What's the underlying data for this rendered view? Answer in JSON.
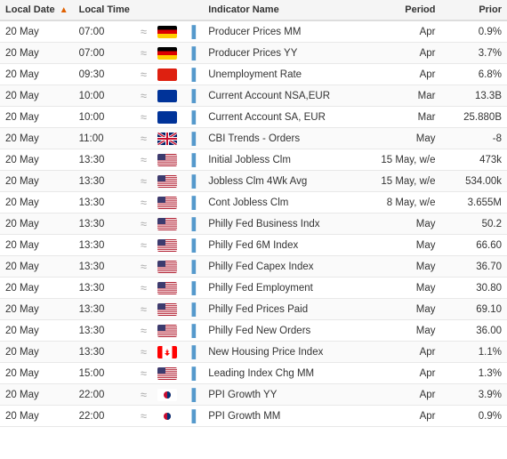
{
  "header": {
    "col_date": "Local Date",
    "col_time": "Local Time",
    "col_name": "Indicator Name",
    "col_period": "Period",
    "col_prior": "Prior"
  },
  "rows": [
    {
      "date": "20 May",
      "time": "07:00",
      "tilde": "≈",
      "flag": "de",
      "name": "Producer Prices MM",
      "period": "Apr",
      "prior": "0.9%"
    },
    {
      "date": "20 May",
      "time": "07:00",
      "tilde": "≈",
      "flag": "de",
      "name": "Producer Prices YY",
      "period": "Apr",
      "prior": "3.7%"
    },
    {
      "date": "20 May",
      "time": "09:30",
      "tilde": "≈",
      "flag": "hk",
      "name": "Unemployment Rate",
      "period": "Apr",
      "prior": "6.8%"
    },
    {
      "date": "20 May",
      "time": "10:00",
      "tilde": "≈",
      "flag": "eu",
      "name": "Current Account NSA,EUR",
      "period": "Mar",
      "prior": "13.3B"
    },
    {
      "date": "20 May",
      "time": "10:00",
      "tilde": "≈",
      "flag": "eu",
      "name": "Current Account SA, EUR",
      "period": "Mar",
      "prior": "25.880B"
    },
    {
      "date": "20 May",
      "time": "11:00",
      "tilde": "≈",
      "flag": "gb",
      "name": "CBI Trends - Orders",
      "period": "May",
      "prior": "-8"
    },
    {
      "date": "20 May",
      "time": "13:30",
      "tilde": "≈",
      "flag": "us",
      "name": "Initial Jobless Clm",
      "period": "15 May, w/e",
      "prior": "473k"
    },
    {
      "date": "20 May",
      "time": "13:30",
      "tilde": "≈",
      "flag": "us",
      "name": "Jobless Clm 4Wk Avg",
      "period": "15 May, w/e",
      "prior": "534.00k"
    },
    {
      "date": "20 May",
      "time": "13:30",
      "tilde": "≈",
      "flag": "us",
      "name": "Cont Jobless Clm",
      "period": "8 May, w/e",
      "prior": "3.655M"
    },
    {
      "date": "20 May",
      "time": "13:30",
      "tilde": "≈",
      "flag": "us",
      "name": "Philly Fed Business Indx",
      "period": "May",
      "prior": "50.2"
    },
    {
      "date": "20 May",
      "time": "13:30",
      "tilde": "≈",
      "flag": "us",
      "name": "Philly Fed 6M Index",
      "period": "May",
      "prior": "66.60"
    },
    {
      "date": "20 May",
      "time": "13:30",
      "tilde": "≈",
      "flag": "us",
      "name": "Philly Fed Capex Index",
      "period": "May",
      "prior": "36.70"
    },
    {
      "date": "20 May",
      "time": "13:30",
      "tilde": "≈",
      "flag": "us",
      "name": "Philly Fed Employment",
      "period": "May",
      "prior": "30.80"
    },
    {
      "date": "20 May",
      "time": "13:30",
      "tilde": "≈",
      "flag": "us",
      "name": "Philly Fed Prices Paid",
      "period": "May",
      "prior": "69.10"
    },
    {
      "date": "20 May",
      "time": "13:30",
      "tilde": "≈",
      "flag": "us",
      "name": "Philly Fed New Orders",
      "period": "May",
      "prior": "36.00"
    },
    {
      "date": "20 May",
      "time": "13:30",
      "tilde": "≈",
      "flag": "ca",
      "name": "New Housing Price Index",
      "period": "Apr",
      "prior": "1.1%"
    },
    {
      "date": "20 May",
      "time": "15:00",
      "tilde": "≈",
      "flag": "us",
      "name": "Leading Index Chg MM",
      "period": "Apr",
      "prior": "1.3%"
    },
    {
      "date": "20 May",
      "time": "22:00",
      "tilde": "≈",
      "flag": "kr",
      "name": "PPI Growth YY",
      "period": "Apr",
      "prior": "3.9%"
    },
    {
      "date": "20 May",
      "time": "22:00",
      "tilde": "≈",
      "flag": "kr",
      "name": "PPI Growth MM",
      "period": "Apr",
      "prior": "0.9%"
    }
  ]
}
